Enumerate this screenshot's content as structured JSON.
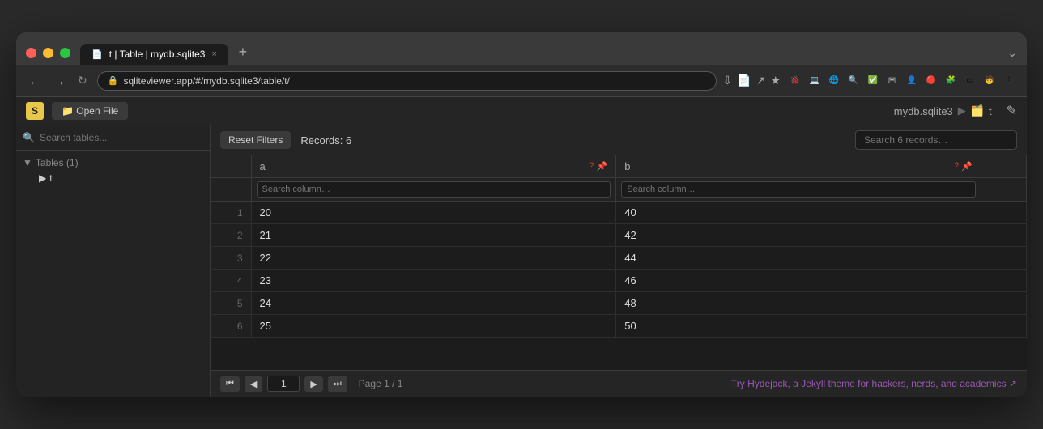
{
  "browser": {
    "tab_title": "t | Table | mydb.sqlite3",
    "tab_icon": "📄",
    "tab_close": "×",
    "tab_add": "+",
    "url": "sqliteviewer.app/#/mydb.sqlite3/table/t/",
    "tab_end_icon": "⌄"
  },
  "app": {
    "open_file_label": "📁 Open File",
    "breadcrumb_db": "mydb.sqlite3",
    "breadcrumb_arrow": "▶",
    "breadcrumb_table": "t",
    "edit_icon": "✎",
    "sidebar_search_placeholder": "Search tables...",
    "tables_section": "Tables (1)",
    "table_item": "t",
    "reset_filters_label": "Reset Filters",
    "records_count": "Records: 6",
    "search_placeholder": "Search 6 records…",
    "columns": [
      {
        "name": "a",
        "has_actions": true
      },
      {
        "name": "b",
        "has_actions": true
      }
    ],
    "col_search_placeholder": "Search column…",
    "rows": [
      {
        "rownum": 1,
        "a": "20",
        "b": "40"
      },
      {
        "rownum": 2,
        "a": "21",
        "b": "42"
      },
      {
        "rownum": 3,
        "a": "22",
        "b": "44"
      },
      {
        "rownum": 4,
        "a": "23",
        "b": "46"
      },
      {
        "rownum": 5,
        "a": "24",
        "b": "48"
      },
      {
        "rownum": 6,
        "a": "25",
        "b": "50"
      }
    ],
    "page_first": "⏮",
    "page_prev": "◀",
    "page_current": "1",
    "page_next": "▶",
    "page_last": "⏭",
    "page_info": "Page 1 / 1",
    "hydejack_link": "Try Hydejack, a Jekyll theme for hackers, nerds, and academics ↗"
  }
}
